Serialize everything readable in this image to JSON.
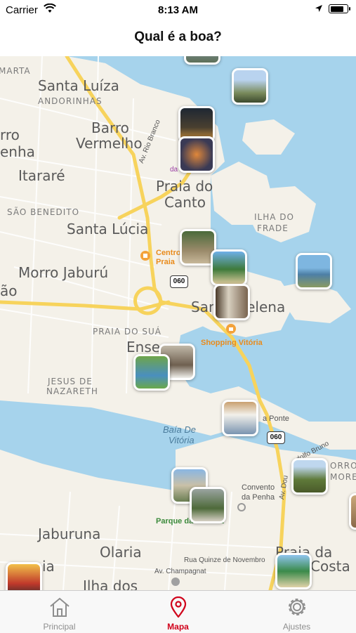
{
  "status_bar": {
    "carrier": "Carrier",
    "time": "8:13 AM"
  },
  "nav": {
    "title": "Qual é a boa?"
  },
  "map": {
    "labels": {
      "marta": "MARTA",
      "santa_luiza": "Santa Luíza",
      "andorinhas": "ANDORINHAS",
      "bairro_left1": "rro",
      "bairro_left2": "enha",
      "barro": "Barro",
      "vermelho": "Vermelho",
      "itarare": "Itararé",
      "sao_benedito": "SÃO BENEDITO",
      "praia_do": "Praia do",
      "canto": "Canto",
      "ilha_do": "ILHA DO",
      "frade": "FRADE",
      "santa_lucia": "Santa Lúcia",
      "morro_jaburu": "Morro Jaburú",
      "ao": "ão",
      "santa_helena": "Santa Helena",
      "praia_do_sua": "PRAIA DO SUÁ",
      "ense": "Ense",
      "jesus_de": "JESUS DE",
      "nazareth": "NAZARETH",
      "baia_de": "Baía De",
      "vitoria": "Vitória",
      "a_ponte": "a Ponte",
      "convento": "Convento",
      "da_penha": "da Penha",
      "parque": "Parque da Prainha",
      "jaburuna": "Jaburuna",
      "olaria": "Olaria",
      "ia": "ia",
      "ilha_dos": "Ilha dos",
      "praia_da": "Praia da",
      "costa": "Costa",
      "orro": "ORRO",
      "more": "MORE",
      "centro1": "Centro",
      "centro2": "Praia",
      "shopping": "Shopping Vitória",
      "dalas": "da       as",
      "av_rio_branco": "Av. Rio Branco",
      "av_dourado": "Av. Dou",
      "av_champagnat": "Av. Champagnat",
      "rua_quinze": "Rua Quinze de Novembro",
      "adolfo": "dolfo Bruno"
    },
    "road_badges": [
      "060",
      "060"
    ]
  },
  "tabs": [
    {
      "label": "Principal",
      "icon": "house-icon",
      "active": false
    },
    {
      "label": "Mapa",
      "icon": "map-pin-icon",
      "active": true
    },
    {
      "label": "Ajustes",
      "icon": "gear-icon",
      "active": false
    }
  ],
  "colors": {
    "accent": "#d0021b",
    "water": "#a6d3ec",
    "land": "#f4f1e9",
    "road_major": "#f7d35c"
  }
}
